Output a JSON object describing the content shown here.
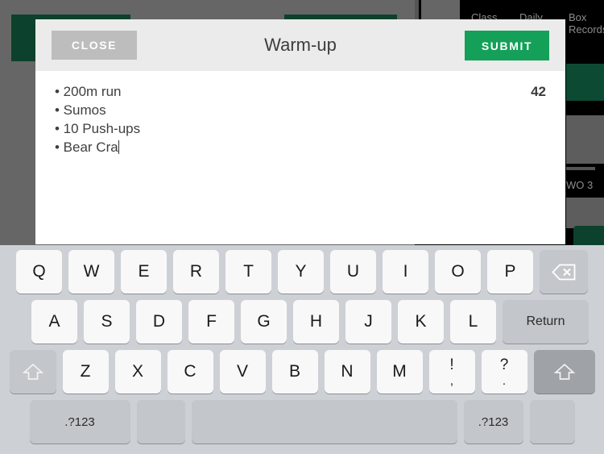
{
  "background": {
    "tabs": [
      "Class",
      "Daily",
      "Box Records"
    ],
    "label_wo": "WO 3"
  },
  "modal": {
    "close_label": "CLOSE",
    "title": "Warm-up",
    "submit_label": "SUBMIT",
    "char_counter": "42",
    "body_text": "• 200m run\n• Sumos\n• 10 Push-ups\n• Bear Cra",
    "accent_green": "#14a058",
    "header_bg": "#ebebeb",
    "close_bg": "#bdbdbd"
  },
  "keyboard": {
    "row1": [
      "Q",
      "W",
      "E",
      "R",
      "T",
      "Y",
      "U",
      "I",
      "O",
      "P"
    ],
    "row2": [
      "A",
      "S",
      "D",
      "F",
      "G",
      "H",
      "J",
      "K",
      "L"
    ],
    "row3": [
      "Z",
      "X",
      "C",
      "V",
      "B",
      "N",
      "M"
    ],
    "return_label": "Return",
    "punct1_top": "!",
    "punct1_bottom": ",",
    "punct2_top": "?",
    "punct2_bottom": ".",
    "numeric_label": ".?123",
    "numeric_label_right": ".?123",
    "bg_color": "#cdd0d4",
    "key_color": "#f8f8f8"
  }
}
